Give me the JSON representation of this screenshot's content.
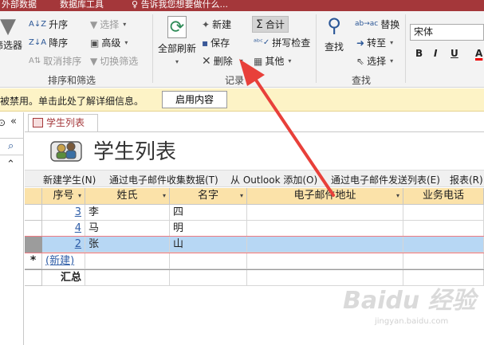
{
  "tabstrip": {
    "tab1": "外部数据",
    "tab2": "数据库工具",
    "tellme": "告诉我您想要做什么..."
  },
  "ribbon": {
    "sort_filter": {
      "filter_label": "筛选器",
      "asc": "升序",
      "desc": "降序",
      "clear_sort": "取消排序",
      "selection": "选择",
      "advanced": "高级",
      "toggle_filter": "切换筛选",
      "group": "排序和筛选"
    },
    "records": {
      "refresh_all": "全部刷新",
      "new": "新建",
      "save": "保存",
      "delete": "删除",
      "totals": "合计",
      "spelling": "拼写检查",
      "more": "其他",
      "group": "记录"
    },
    "find": {
      "find": "查找",
      "replace": "替换",
      "goto": "转至",
      "select": "选择",
      "group": "查找"
    },
    "text": {
      "font": "宋体",
      "bold": "B",
      "italic": "I",
      "underline": "U",
      "color": "A"
    }
  },
  "msgbar": {
    "text": "被禁用。单击此处了解详细信息。",
    "button": "启用内容"
  },
  "nav": {
    "collapse": "«",
    "search": "⌕",
    "expand": "⌃"
  },
  "doc": {
    "tab": "学生列表",
    "title": "学生列表",
    "toolbar": [
      "新建学生(N)",
      "通过电子邮件收集数据(T)",
      "从 Outlook 添加(O)",
      "通过电子邮件发送列表(E)",
      "报表(R)"
    ],
    "columns": [
      "序号",
      "姓氏",
      "名字",
      "电子邮件地址",
      "业务电话"
    ],
    "rows": [
      {
        "id": "3",
        "last": "李",
        "first": "四"
      },
      {
        "id": "4",
        "last": "马",
        "first": "明"
      },
      {
        "id": "2",
        "last": "张",
        "first": "山"
      }
    ],
    "new_row_marker": "*",
    "new_row_label": "(新建)",
    "totals_label": "汇总"
  },
  "watermark": {
    "main": "Baidu 经验",
    "sub": "jingyan.baidu.com"
  },
  "colors": {
    "accent": "#a4373a",
    "header": "#fbe2a9",
    "selected_row": "#b7d7f4",
    "arrow": "#e8403a"
  }
}
